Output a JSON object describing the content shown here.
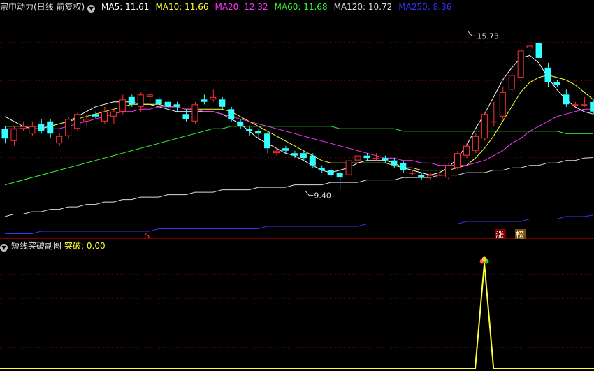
{
  "main_header": {
    "title": "宗申动力(日线 前复权)",
    "ma_items": [
      {
        "label": "MA5: 11.61",
        "color": "#ffffff"
      },
      {
        "label": "MA10: 11.66",
        "color": "#ffff33"
      },
      {
        "label": "MA20: 12.32",
        "color": "#ff33ff"
      },
      {
        "label": "MA60: 11.68",
        "color": "#33ff33"
      },
      {
        "label": "MA120: 10.72",
        "color": "#dcdcdc"
      },
      {
        "label": "MA250: 8.36",
        "color": "#3333ff"
      }
    ]
  },
  "sub_header": {
    "title": "短线突破副图",
    "value_label": "突破: 0.00",
    "value_color": "#ffff33"
  },
  "icons": {
    "collapse": "chevron-down-icon"
  },
  "markers": {
    "dollar": "$",
    "zhang": "涨",
    "bang": "榜"
  },
  "colors": {
    "up": "#ff3333",
    "down": "#33ffff",
    "background": "#000000"
  },
  "chart_data": [
    {
      "type": "candlestick",
      "title": "宗申动力(日线 前复权)",
      "price_range": [
        7.5,
        16.6
      ],
      "annotations": [
        {
          "label": "15.73",
          "kind": "high",
          "value": 15.73,
          "index": 51
        },
        {
          "label": "9.40",
          "kind": "low",
          "value": 9.4,
          "index": 33
        }
      ],
      "candles": [
        [
          11.9,
          11.5,
          12.0,
          11.3
        ],
        [
          11.4,
          11.9,
          12.0,
          11.2
        ],
        [
          11.9,
          12.0,
          12.2,
          11.8
        ],
        [
          11.7,
          12.0,
          12.2,
          11.6
        ],
        [
          12.1,
          11.8,
          12.3,
          11.7
        ],
        [
          12.2,
          11.7,
          12.3,
          11.5
        ],
        [
          11.3,
          11.6,
          11.7,
          11.2
        ],
        [
          11.6,
          12.3,
          12.4,
          11.5
        ],
        [
          11.9,
          12.5,
          12.6,
          11.8
        ],
        [
          12.2,
          12.3,
          12.5,
          12.0
        ],
        [
          12.5,
          12.4,
          12.6,
          12.3
        ],
        [
          12.2,
          12.6,
          12.8,
          12.1
        ],
        [
          12.4,
          12.6,
          12.7,
          12.1
        ],
        [
          12.6,
          13.1,
          13.3,
          12.5
        ],
        [
          13.2,
          12.9,
          13.3,
          12.8
        ],
        [
          12.8,
          13.3,
          13.4,
          12.6
        ],
        [
          13.2,
          13.3,
          13.4,
          13.0
        ],
        [
          13.1,
          12.9,
          13.2,
          12.8
        ],
        [
          13.0,
          12.8,
          13.1,
          12.7
        ],
        [
          12.9,
          12.8,
          13.0,
          12.6
        ],
        [
          12.5,
          12.3,
          12.7,
          12.2
        ],
        [
          12.2,
          12.9,
          13.0,
          12.1
        ],
        [
          13.1,
          13.0,
          13.3,
          12.9
        ],
        [
          13.1,
          13.2,
          13.5,
          13.0
        ],
        [
          13.1,
          12.8,
          13.2,
          12.7
        ],
        [
          12.7,
          12.3,
          12.8,
          12.2
        ],
        [
          12.2,
          12.0,
          12.3,
          11.9
        ],
        [
          11.9,
          11.8,
          12.0,
          11.6
        ],
        [
          11.8,
          11.7,
          11.9,
          11.5
        ],
        [
          11.7,
          11.1,
          11.8,
          10.9
        ],
        [
          10.9,
          11.0,
          11.1,
          10.8
        ],
        [
          11.1,
          11.0,
          11.2,
          10.9
        ],
        [
          10.9,
          10.8,
          11.0,
          10.7
        ],
        [
          10.9,
          10.7,
          11.0,
          10.6
        ],
        [
          10.8,
          10.4,
          10.9,
          10.3
        ],
        [
          10.3,
          10.2,
          10.4,
          10.1
        ],
        [
          10.2,
          10.0,
          10.3,
          9.9
        ],
        [
          10.1,
          9.9,
          10.2,
          9.4
        ],
        [
          10.0,
          10.6,
          10.7,
          9.9
        ],
        [
          10.6,
          10.8,
          11.0,
          10.5
        ],
        [
          10.8,
          10.7,
          10.9,
          10.6
        ],
        [
          10.7,
          10.7,
          10.9,
          10.6
        ],
        [
          10.7,
          10.6,
          10.8,
          10.5
        ],
        [
          10.6,
          10.4,
          10.7,
          10.3
        ],
        [
          10.5,
          10.2,
          10.6,
          10.1
        ],
        [
          10.1,
          10.1,
          10.2,
          10.0
        ],
        [
          10.0,
          9.9,
          10.1,
          9.8
        ],
        [
          9.9,
          10.0,
          10.1,
          9.8
        ],
        [
          9.9,
          10.0,
          10.1,
          9.9
        ],
        [
          9.9,
          10.4,
          10.5,
          9.8
        ],
        [
          10.3,
          10.9,
          11.0,
          10.2
        ],
        [
          10.8,
          11.2,
          11.3,
          10.7
        ],
        [
          11.0,
          11.6,
          11.7,
          10.9
        ],
        [
          11.5,
          12.5,
          12.6,
          11.4
        ],
        [
          12.2,
          12.2,
          13.0,
          12.0
        ],
        [
          12.4,
          13.4,
          13.6,
          12.3
        ],
        [
          13.5,
          14.1,
          14.2,
          13.4
        ],
        [
          14.0,
          15.1,
          15.3,
          13.9
        ],
        [
          15.2,
          15.3,
          15.7,
          15.0
        ],
        [
          15.4,
          14.8,
          15.6,
          14.5
        ],
        [
          14.4,
          13.8,
          14.6,
          13.6
        ],
        [
          13.8,
          13.7,
          13.9,
          13.6
        ],
        [
          13.3,
          12.9,
          13.5,
          12.8
        ],
        [
          12.9,
          12.9,
          13.0,
          12.8
        ],
        [
          12.9,
          12.9,
          13.2,
          12.8
        ],
        [
          13.0,
          12.6,
          13.1,
          12.5
        ]
      ],
      "series": [
        {
          "name": "MA5",
          "color": "#ffffff",
          "values": [
            12.4,
            12.2,
            12.0,
            11.9,
            11.9,
            12.0,
            12.1,
            12.2,
            12.4,
            12.6,
            12.8,
            12.9,
            13.0,
            13.0,
            13.0,
            12.9,
            12.9,
            12.8,
            12.7,
            12.6,
            12.6,
            12.6,
            12.6,
            12.6,
            12.5,
            12.3,
            12.1,
            11.8,
            11.5,
            11.3,
            11.1,
            10.9,
            10.8,
            10.6,
            10.4,
            10.2,
            10.1,
            10.2,
            10.3,
            10.5,
            10.6,
            10.6,
            10.6,
            10.5,
            10.3,
            10.2,
            10.1,
            10.0,
            10.1,
            10.3,
            10.7,
            11.2,
            11.9,
            12.5,
            13.2,
            13.9,
            14.4,
            14.8,
            14.9,
            14.6,
            14.0,
            13.5,
            13.1,
            12.8,
            12.6,
            12.5
          ]
        },
        {
          "name": "MA10",
          "color": "#ffff33",
          "values": [
            12.0,
            12.0,
            12.0,
            12.0,
            12.0,
            12.0,
            12.1,
            12.2,
            12.3,
            12.4,
            12.5,
            12.6,
            12.7,
            12.8,
            12.9,
            12.9,
            12.9,
            12.9,
            12.8,
            12.8,
            12.7,
            12.7,
            12.7,
            12.7,
            12.7,
            12.6,
            12.4,
            12.2,
            12.0,
            11.8,
            11.6,
            11.4,
            11.2,
            11.0,
            10.8,
            10.6,
            10.5,
            10.5,
            10.5,
            10.5,
            10.5,
            10.5,
            10.5,
            10.4,
            10.3,
            10.3,
            10.2,
            10.2,
            10.2,
            10.2,
            10.3,
            10.4,
            10.7,
            11.1,
            11.6,
            12.2,
            12.8,
            13.4,
            13.8,
            14.0,
            14.1,
            14.0,
            13.9,
            13.7,
            13.4,
            13.1
          ]
        },
        {
          "name": "MA20",
          "color": "#ff33ff",
          "values": [
            11.9,
            11.9,
            11.9,
            11.9,
            11.9,
            11.9,
            11.9,
            12.0,
            12.1,
            12.2,
            12.3,
            12.4,
            12.5,
            12.6,
            12.6,
            12.7,
            12.7,
            12.8,
            12.8,
            12.8,
            12.7,
            12.7,
            12.6,
            12.6,
            12.5,
            12.4,
            12.3,
            12.2,
            12.1,
            12.0,
            11.9,
            11.8,
            11.7,
            11.6,
            11.5,
            11.4,
            11.3,
            11.2,
            11.1,
            11.0,
            10.9,
            10.8,
            10.7,
            10.7,
            10.6,
            10.6,
            10.5,
            10.5,
            10.4,
            10.4,
            10.4,
            10.4,
            10.5,
            10.6,
            10.8,
            11.0,
            11.3,
            11.5,
            11.8,
            12.0,
            12.2,
            12.4,
            12.5,
            12.6,
            12.7,
            12.7
          ]
        },
        {
          "name": "MA60",
          "color": "#33ff33",
          "values": [
            9.6,
            9.7,
            9.8,
            9.9,
            10.0,
            10.1,
            10.2,
            10.3,
            10.4,
            10.5,
            10.6,
            10.7,
            10.8,
            10.9,
            11.0,
            11.1,
            11.2,
            11.3,
            11.4,
            11.5,
            11.6,
            11.7,
            11.8,
            11.9,
            11.9,
            12.0,
            12.0,
            12.0,
            12.0,
            12.0,
            12.0,
            12.0,
            12.0,
            12.0,
            12.0,
            12.0,
            12.0,
            11.9,
            11.9,
            11.9,
            11.9,
            11.9,
            11.9,
            11.9,
            11.8,
            11.8,
            11.8,
            11.8,
            11.8,
            11.8,
            11.8,
            11.8,
            11.8,
            11.8,
            11.8,
            11.8,
            11.8,
            11.8,
            11.8,
            11.8,
            11.8,
            11.8,
            11.7,
            11.7,
            11.7,
            11.7
          ]
        },
        {
          "name": "MA120",
          "color": "#dcdcdc",
          "values": [
            8.3,
            8.4,
            8.4,
            8.5,
            8.5,
            8.6,
            8.6,
            8.7,
            8.7,
            8.8,
            8.8,
            8.9,
            8.9,
            9.0,
            9.0,
            9.1,
            9.1,
            9.1,
            9.2,
            9.2,
            9.2,
            9.3,
            9.3,
            9.3,
            9.4,
            9.4,
            9.4,
            9.4,
            9.5,
            9.5,
            9.5,
            9.5,
            9.6,
            9.6,
            9.6,
            9.6,
            9.7,
            9.7,
            9.7,
            9.7,
            9.8,
            9.8,
            9.8,
            9.8,
            9.9,
            9.9,
            9.9,
            9.9,
            10.0,
            10.0,
            10.0,
            10.1,
            10.1,
            10.1,
            10.2,
            10.2,
            10.3,
            10.3,
            10.4,
            10.4,
            10.5,
            10.5,
            10.6,
            10.6,
            10.7,
            10.72
          ]
        },
        {
          "name": "MA250",
          "color": "#3333ff",
          "values": [
            7.6,
            7.6,
            7.6,
            7.6,
            7.7,
            7.7,
            7.7,
            7.7,
            7.7,
            7.7,
            7.7,
            7.7,
            7.7,
            7.7,
            7.7,
            7.7,
            7.7,
            7.8,
            7.8,
            7.8,
            7.8,
            7.8,
            7.8,
            7.8,
            7.8,
            7.8,
            7.8,
            7.8,
            7.8,
            7.9,
            7.9,
            7.9,
            7.9,
            7.9,
            7.9,
            7.9,
            7.9,
            7.9,
            7.9,
            7.9,
            8.0,
            8.0,
            8.0,
            8.0,
            8.0,
            8.0,
            8.0,
            8.0,
            8.0,
            8.0,
            8.0,
            8.1,
            8.1,
            8.1,
            8.1,
            8.1,
            8.1,
            8.1,
            8.2,
            8.2,
            8.2,
            8.2,
            8.3,
            8.3,
            8.3,
            8.36
          ]
        }
      ]
    },
    {
      "type": "line",
      "title": "短线突破副图",
      "ylim": [
        0,
        1
      ],
      "series": [
        {
          "name": "突破",
          "color": "#ffff33",
          "values": [
            0,
            0,
            0,
            0,
            0,
            0,
            0,
            0,
            0,
            0,
            0,
            0,
            0,
            0,
            0,
            0,
            0,
            0,
            0,
            0,
            0,
            0,
            0,
            0,
            0,
            0,
            0,
            0,
            0,
            0,
            0,
            0,
            0,
            0,
            0,
            0,
            0,
            0,
            0,
            0,
            0,
            0,
            0,
            0,
            0,
            0,
            0,
            0,
            0,
            0,
            0,
            0,
            0,
            1,
            0,
            0,
            0,
            0,
            0,
            0,
            0,
            0,
            0,
            0,
            0,
            0
          ]
        }
      ],
      "signal_index": 53
    }
  ]
}
